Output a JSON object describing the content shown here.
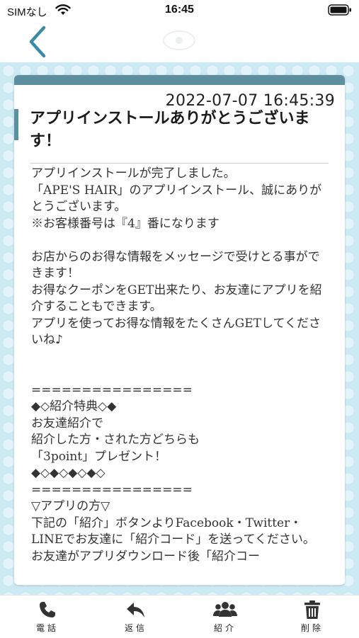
{
  "status_bar": {
    "carrier": "SIMなし",
    "time": "16:45",
    "icons": [
      "wifi-icon",
      "battery-icon"
    ]
  },
  "nav": {
    "back_icon": "chevron-left-icon",
    "logo_icon": "shop-logo-icon"
  },
  "colors": {
    "accent": "#5e8f9e",
    "back_arrow": "#3d8aa6",
    "background": "#cde9f3",
    "dots": "#e3f4fa"
  },
  "message": {
    "timestamp": "2022-07-07 16:45:39",
    "title": "アプリインストールありがとうございます！",
    "body": "アプリインストールが完了しました。\n「APE'S HAIR」のアプリインストール、誠にありがとうございます。\n※お客様番号は『4』番になります\n\nお店からのお得な情報をメッセージで受けとる事ができます！\nお得なクーポンをGET出来たり、お友達にアプリを紹介することもできます。\nアプリを使ってお得な情報をたくさんGETしてくださいね♪\n\n\n================\n◆◇紹介特典◇◆\nお友達紹介で\n紹介した方・された方どちらも\n「3point」プレゼント！\n◆◇◆◇◆◇◆◇\n================\n▽アプリの方▽\n下記の「紹介」ボタンよりFacebook・Twitter・LINEでお友達に「紹介コード」を送ってください。\nお友達がアプリダウンロード後「紹介コー"
  },
  "tabs": [
    {
      "label": "電話",
      "icon": "phone-icon"
    },
    {
      "label": "返信",
      "icon": "reply-icon"
    },
    {
      "label": "紹介",
      "icon": "users-icon"
    },
    {
      "label": "削除",
      "icon": "trash-icon"
    }
  ]
}
